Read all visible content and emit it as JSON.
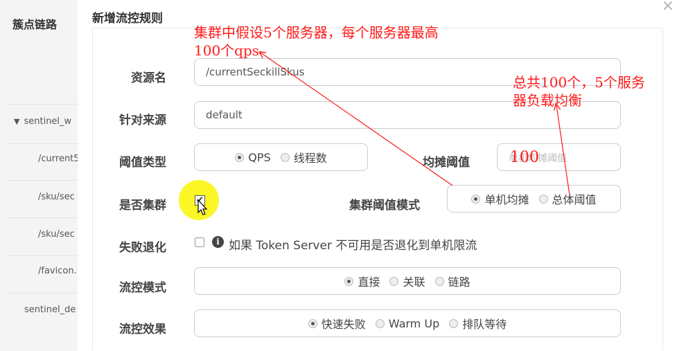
{
  "sidebar": {
    "title": "簇点链路",
    "items": [
      {
        "label": "sentinel_w",
        "expanded": true
      },
      {
        "label": "/current5"
      },
      {
        "label": "/sku/sec"
      },
      {
        "label": "/sku/sec"
      },
      {
        "label": "/favicon."
      },
      {
        "label": "sentinel_de"
      }
    ]
  },
  "modal": {
    "title": "新增流控规则",
    "close_glyph": "×",
    "resource": {
      "label": "资源名",
      "value": "/currentSeckillSkus"
    },
    "source": {
      "label": "针对来源",
      "value": "default"
    },
    "threshold_type": {
      "label": "阈值类型",
      "options": [
        {
          "label": "QPS",
          "checked": true
        },
        {
          "label": "线程数",
          "checked": false
        }
      ]
    },
    "avg_threshold": {
      "label": "均摊阈值",
      "placeholder": "单机均摊阈值",
      "value": "100"
    },
    "cluster": {
      "label": "是否集群",
      "checked": true
    },
    "cluster_mode": {
      "label": "集群阈值模式",
      "options": [
        {
          "label": "单机均摊",
          "checked": true
        },
        {
          "label": "总体阈值",
          "checked": false
        }
      ]
    },
    "fallback": {
      "label": "失败退化",
      "checked": false,
      "info_glyph": "i",
      "text": "如果 Token Server 不可用是否退化到单机限流"
    },
    "flow_mode": {
      "label": "流控模式",
      "options": [
        {
          "label": "直接",
          "checked": true
        },
        {
          "label": "关联",
          "checked": false
        },
        {
          "label": "链路",
          "checked": false
        }
      ]
    },
    "flow_effect": {
      "label": "流控效果",
      "options": [
        {
          "label": "快速失败",
          "checked": true
        },
        {
          "label": "Warm Up",
          "checked": false
        },
        {
          "label": "排队等待",
          "checked": false
        }
      ]
    }
  },
  "annotations": {
    "note1_line1": "集群中假设5个服务器，每个服务器最高",
    "note1_line2": "100个qps",
    "note2_line1": "总共100个，5个服务",
    "note2_line2": "器负载均衡",
    "color": "#ff1a1a"
  }
}
